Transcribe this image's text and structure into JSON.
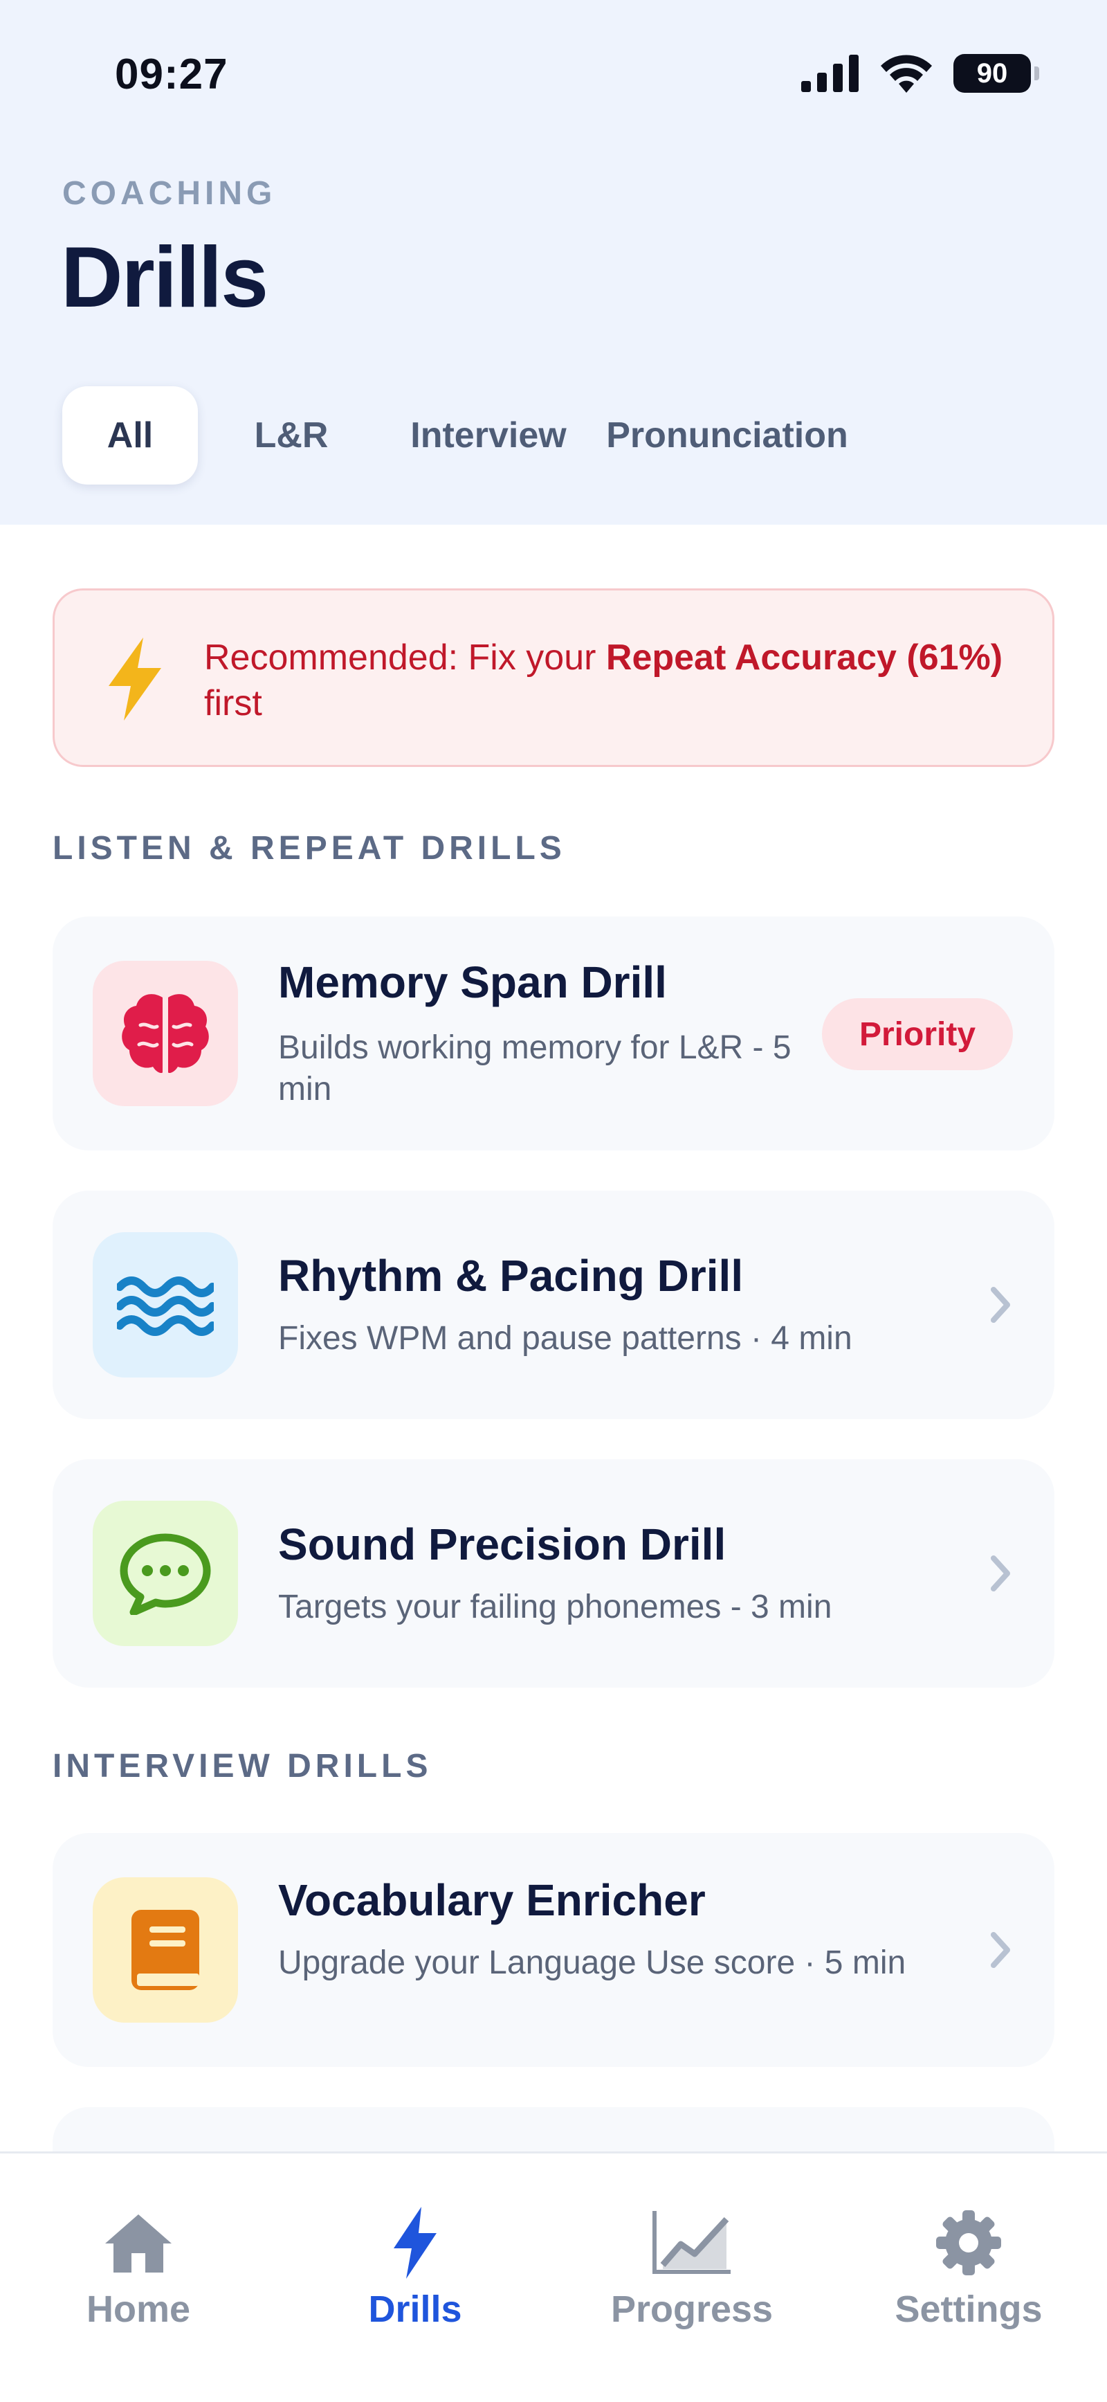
{
  "status": {
    "time": "09:27",
    "battery": "90"
  },
  "header": {
    "eyebrow": "COACHING",
    "title": "Drills",
    "tabs": [
      {
        "label": "All",
        "active": true
      },
      {
        "label": "L&R",
        "active": false
      },
      {
        "label": "Interview",
        "active": false
      },
      {
        "label": "Pronunciation",
        "active": false
      }
    ]
  },
  "recommendation": {
    "prefix": "Recommended: Fix your ",
    "highlight": "Repeat Accuracy (61%)",
    "suffix": " first",
    "icon": "lightning-icon"
  },
  "sections": [
    {
      "title": "LISTEN & REPEAT DRILLS",
      "drills": [
        {
          "title": "Memory Span Drill",
          "subtitle": "Builds working memory for L&R - 5 min",
          "icon": "brain-icon",
          "badge": "Priority"
        },
        {
          "title": "Rhythm & Pacing Drill",
          "subtitle": "Fixes WPM and pause patterns · 4 min",
          "icon": "waves-icon"
        },
        {
          "title": "Sound Precision Drill",
          "subtitle": "Targets your failing phonemes - 3 min",
          "icon": "speech-bubble-icon"
        }
      ]
    },
    {
      "title": "INTERVIEW DRILLS",
      "drills": [
        {
          "title": "Vocabulary Enricher",
          "subtitle": "Upgrade your Language Use score · 5 min",
          "icon": "book-icon"
        }
      ]
    }
  ],
  "tabbar": [
    {
      "label": "Home",
      "icon": "home-icon",
      "active": false
    },
    {
      "label": "Drills",
      "icon": "bolt-icon",
      "active": true
    },
    {
      "label": "Progress",
      "icon": "chart-icon",
      "active": false
    },
    {
      "label": "Settings",
      "icon": "gear-icon",
      "active": false
    }
  ],
  "colors": {
    "accent": "#1f55dc",
    "danger": "#c0182a",
    "header_bg": "#eef3fd",
    "card_bg": "#f7f9fc"
  }
}
